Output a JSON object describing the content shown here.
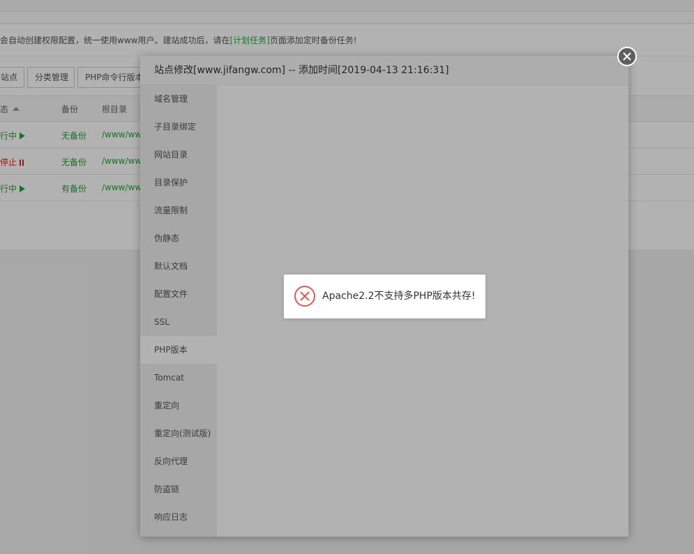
{
  "background": {
    "notice_pre": "会自动创建权限配置，统一使用www用户。建站成功后，请在",
    "notice_link": "[计划任务]",
    "notice_post": "页面添加定时备份任务!",
    "toolbar": {
      "add_site_fragment": "站点",
      "category_button": "分类管理",
      "php_cli_button": "PHP命令行版本"
    },
    "table": {
      "headers": {
        "status": "态",
        "backup": "备份",
        "root": "根目录"
      },
      "rows": [
        {
          "status": "行中",
          "state": "running",
          "backup": "无备份",
          "path": "/www/ww"
        },
        {
          "status": "停止",
          "state": "stopped",
          "backup": "无备份",
          "path": "/www/ww"
        },
        {
          "status": "行中",
          "state": "running",
          "backup": "有备份",
          "path": "/www/ww"
        }
      ]
    }
  },
  "modal": {
    "title": "站点修改[www.jifangw.com] -- 添加时间[2019-04-13 21:16:31]",
    "menu": [
      {
        "label": "域名管理"
      },
      {
        "label": "子目录绑定"
      },
      {
        "label": "网站目录"
      },
      {
        "label": "目录保护"
      },
      {
        "label": "流量限制"
      },
      {
        "label": "伪静态"
      },
      {
        "label": "默认文档"
      },
      {
        "label": "配置文件"
      },
      {
        "label": "SSL"
      },
      {
        "label": "PHP版本",
        "active": true
      },
      {
        "label": "Tomcat"
      },
      {
        "label": "重定向"
      },
      {
        "label": "重定向(测试版)"
      },
      {
        "label": "反向代理"
      },
      {
        "label": "防盗链"
      },
      {
        "label": "响应日志"
      }
    ]
  },
  "toast": {
    "message": "Apache2.2不支持多PHP版本共存!",
    "icon": "error-circle-icon"
  },
  "colors": {
    "accent_green": "#20a53a",
    "stopped_red": "#e21c1c",
    "error_icon": "#e8584f"
  }
}
